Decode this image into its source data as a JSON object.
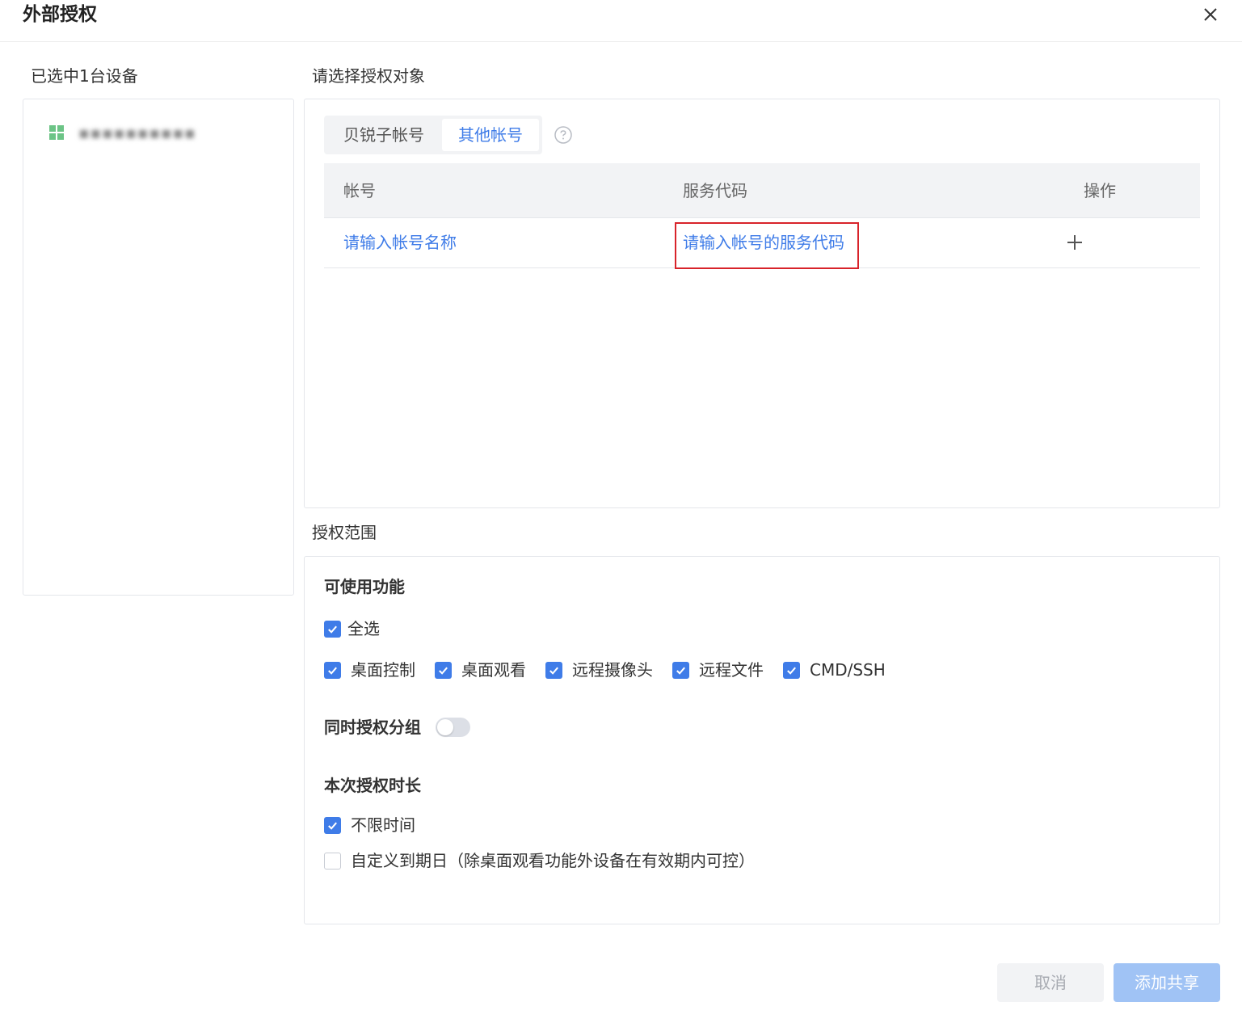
{
  "dialog": {
    "title": "外部授权",
    "close_icon": "close-icon"
  },
  "left": {
    "label": "已选中1台设备",
    "device": {
      "icon": "windows-icon",
      "name": "▪▪▪▪▪▪▪▪▪▪"
    }
  },
  "target": {
    "label": "请选择授权对象",
    "tabs": [
      {
        "label": "贝锐子帐号",
        "active": false
      },
      {
        "label": "其他帐号",
        "active": true
      }
    ],
    "help_icon": "question-circle-icon",
    "table": {
      "headers": [
        "帐号",
        "服务代码",
        "操作"
      ],
      "row": {
        "account_placeholder": "请输入帐号名称",
        "code_placeholder": "请输入帐号的服务代码",
        "action_icon": "plus-icon"
      }
    }
  },
  "scope": {
    "label": "授权范围",
    "features_heading": "可使用功能",
    "select_all": {
      "label": "全选",
      "checked": true
    },
    "features": [
      {
        "label": "桌面控制",
        "checked": true
      },
      {
        "label": "桌面观看",
        "checked": true
      },
      {
        "label": "远程摄像头",
        "checked": true
      },
      {
        "label": "远程文件",
        "checked": true
      },
      {
        "label": "CMD/SSH",
        "checked": true
      }
    ],
    "group_toggle": {
      "label": "同时授权分组",
      "on": false
    },
    "duration_heading": "本次授权时长",
    "duration_options": [
      {
        "label": "不限时间",
        "checked": true
      },
      {
        "label": "自定义到期日（除桌面观看功能外设备在有效期内可控）",
        "checked": false
      }
    ]
  },
  "footer": {
    "cancel_label": "取消",
    "submit_label": "添加共享"
  },
  "colors": {
    "accent": "#3f7ce8",
    "highlight_border": "#d8232a",
    "submit_disabled": "#a0c3f5"
  }
}
